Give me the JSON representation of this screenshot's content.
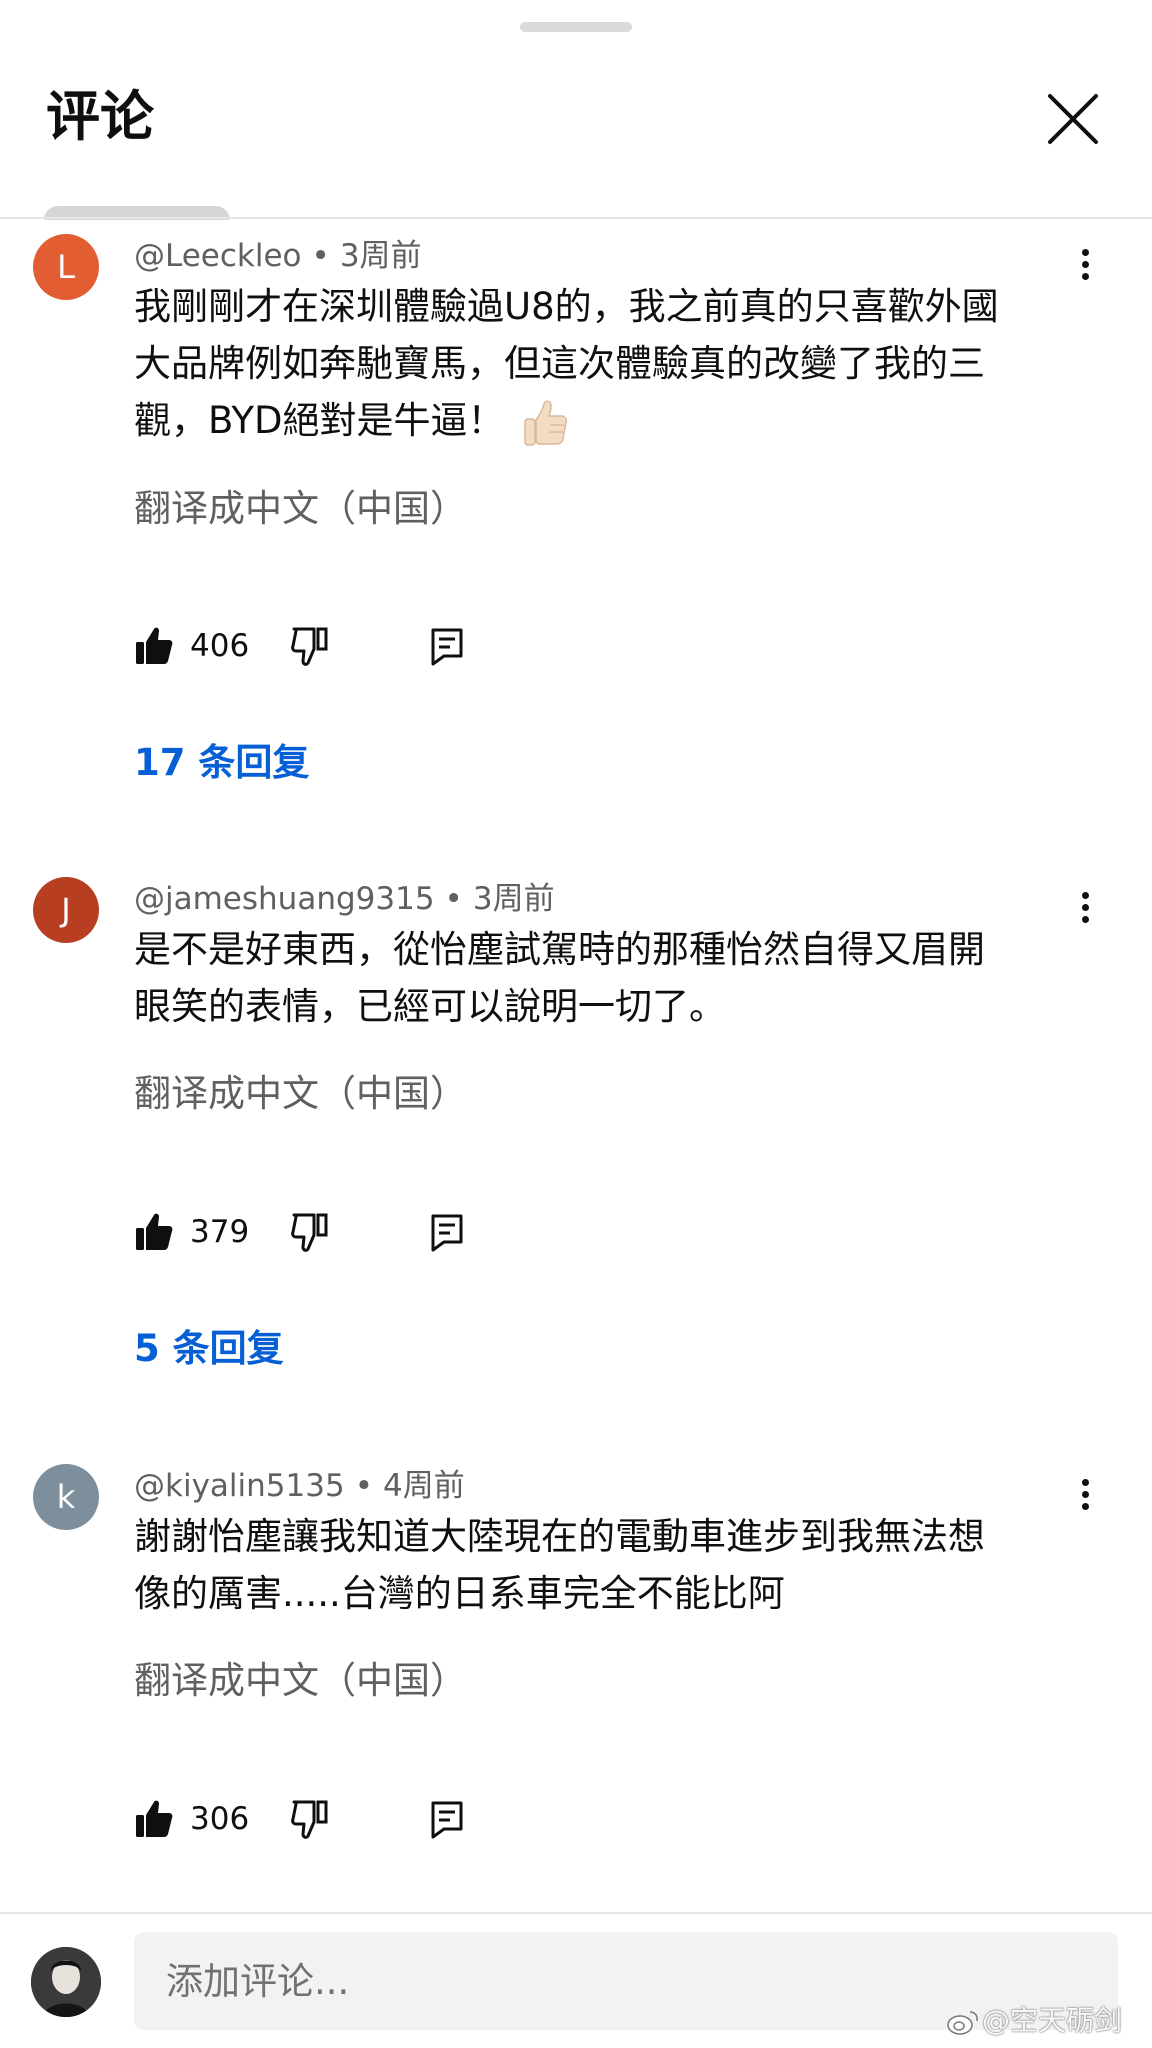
{
  "header": {
    "title": "评论"
  },
  "comments": [
    {
      "avatar_letter": "L",
      "avatar_color": "#e35d32",
      "author": "@Leeckleo",
      "time": "3周前",
      "lines": [
        "我剛剛才在深圳體驗過U8的，我之前真的只喜歡外國",
        "大品牌例如奔馳寶馬，但這次體驗真的改變了我的三",
        "觀，BYD絕對是牛逼！"
      ],
      "emoji": "thumbs-up-emoji",
      "translate_label": "翻译成中文（中国）",
      "likes": "406",
      "replies_label": "17 条回复"
    },
    {
      "avatar_letter": "J",
      "avatar_color": "#b83e22",
      "author": "@jameshuang9315",
      "time": "3周前",
      "lines": [
        "是不是好東西，從怡塵試駕時的那種怡然自得又眉開",
        "眼笑的表情，已經可以說明一切了。"
      ],
      "translate_label": "翻译成中文（中国）",
      "likes": "379",
      "replies_label": "5 条回复"
    },
    {
      "avatar_letter": "k",
      "avatar_color": "#7d8f9c",
      "author": "@kiyalin5135",
      "time": "4周前",
      "lines": [
        "謝謝怡塵讓我知道大陸現在的電動車進步到我無法想",
        "像的厲害.....台灣的日系車完全不能比阿"
      ],
      "translate_label": "翻译成中文（中国）",
      "likes": "306"
    }
  ],
  "separator_dot": "•",
  "composer": {
    "placeholder": "添加评论..."
  },
  "watermark": "@空天砺剑",
  "colors": {
    "link_blue": "#065fd4",
    "secondary_text": "#606060",
    "input_bg": "#f2f2f2"
  }
}
